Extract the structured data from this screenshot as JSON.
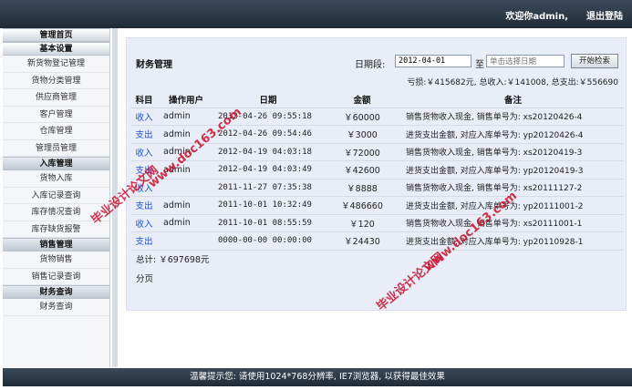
{
  "header": {
    "welcome": "欢迎你admin,",
    "logout": "退出登陆"
  },
  "sidebar": {
    "blocks": [
      {
        "title": "管理首页",
        "items": []
      },
      {
        "title": "基本设置",
        "items": [
          "新货物登记管理",
          "货物分类管理",
          "供应商管理",
          "客户管理",
          "仓库管理",
          "管理员管理"
        ]
      },
      {
        "title": "入库管理",
        "items": [
          "货物入库",
          "入库记录查询",
          "库存情况查询",
          "库存缺货报警"
        ]
      },
      {
        "title": "销售管理",
        "items": [
          "货物销售",
          "销售记录查询"
        ]
      },
      {
        "title": "财务查询",
        "items": [
          "财务查询"
        ]
      }
    ]
  },
  "panel": {
    "title": "财务管理",
    "filter_label": "日期段:",
    "date_start": "2012-04-01",
    "date_sep": "至",
    "date_end_placeholder": "单击选择日期",
    "search_button": "开始检索",
    "summary": "亏损:￥415682元, 总收入:￥141008, 总支出:￥556690",
    "columns": [
      "科目",
      "操作用户",
      "日期",
      "金额",
      "备注"
    ],
    "rows": [
      {
        "kind": "收入",
        "op": "admin",
        "date": "2012-04-26 09:55:18",
        "amount": "￥60000",
        "note": "销售货物收入现金, 销售单号为: xs20120426-4"
      },
      {
        "kind": "支出",
        "op": "admin",
        "date": "2012-04-26 09:54:46",
        "amount": "￥3000",
        "note": "进货支出金额, 对应入库单号为: yp20120426-4"
      },
      {
        "kind": "收入",
        "op": "admin",
        "date": "2012-04-19 04:03:18",
        "amount": "￥72000",
        "note": "销售货物收入现金, 销售单号为: xs20120419-3"
      },
      {
        "kind": "支出",
        "op": "admin",
        "date": "2012-04-19 04:03:49",
        "amount": "￥42600",
        "note": "进货支出金额, 对应入库单号为: yp20120419-3"
      },
      {
        "kind": "收入",
        "op": "",
        "date": "2011-11-27 07:35:38",
        "amount": "￥8888",
        "note": "销售货物收入现金, 销售单号为: xs20111127-2"
      },
      {
        "kind": "支出",
        "op": "admin",
        "date": "2011-10-01 10:32:49",
        "amount": "￥486660",
        "note": "进货支出金额, 对应入库单号为: yp20111001-2"
      },
      {
        "kind": "收入",
        "op": "admin",
        "date": "2011-10-01 08:55:59",
        "amount": "￥120",
        "note": "销售货物收入现金, 销售单号为: xs20111001-1"
      },
      {
        "kind": "支出",
        "op": "",
        "date": "0000-00-00 00:00:00",
        "amount": "￥24430",
        "note": "进货支出金额, 对应入库单号为: yp20110928-1"
      }
    ],
    "total": "总计: ￥697698元",
    "pager": "分页"
  },
  "watermarks": {
    "text1": "毕业设计论文网",
    "url1": "www.doc163.com",
    "text2": "毕业设计论文网",
    "url2": "www.doc163.com"
  },
  "footer": {
    "tip": "温馨提示您:    请使用1024*768分辨率, IE7浏览器, 以获得最佳效果"
  },
  "colors": {
    "bar": "#1f2a36",
    "panel": "#e9edf7",
    "link": "#1d4fd8",
    "watermark": "#c8102e"
  }
}
